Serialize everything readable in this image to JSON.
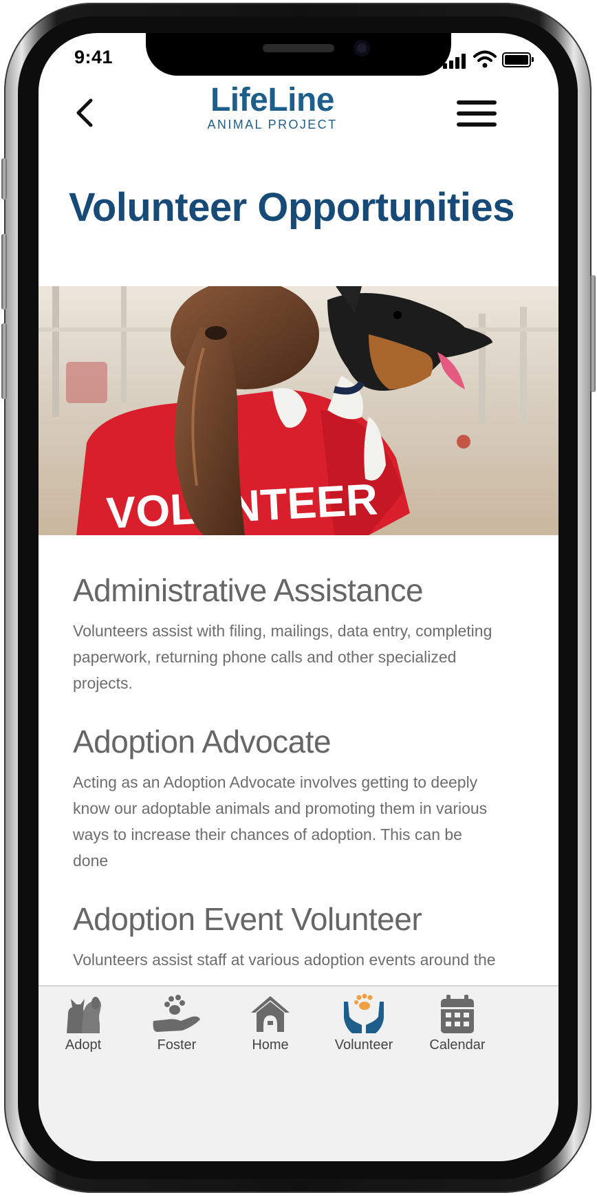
{
  "status_bar": {
    "time": "9:41"
  },
  "header": {
    "logo_name": "LifeLine",
    "logo_subtitle": "ANIMAL PROJECT",
    "back_icon": "chevron-left-icon",
    "menu_icon": "hamburger-menu-icon"
  },
  "page": {
    "title": "Volunteer Opportunities"
  },
  "hero": {
    "shirt_text": "VOLUNTEER"
  },
  "sections": [
    {
      "title": "Administrative Assistance",
      "body": "Volunteers assist with filing, mailings, data entry, completing paperwork, returning phone calls and other specialized projects."
    },
    {
      "title": "Adoption Advocate",
      "body": "Acting as an Adoption Advocate involves getting to deeply know our adoptable animals and promoting them in various ways to increase their chances of adoption. This can be done"
    },
    {
      "title": "Adoption Event Volunteer",
      "body": "Volunteers assist staff at various adoption events around the Atlanta area.  Duties include assisting in set up, maintaining the safety and well-being of the dogs, answering questions"
    }
  ],
  "tabbar": {
    "active": "Volunteer",
    "colors": {
      "inactive": "#6a6a6a",
      "active": "#1d5e8a",
      "paw_accent": "#f0a040"
    },
    "tabs": [
      {
        "label": "Adopt",
        "icon": "cat-dog-icon"
      },
      {
        "label": "Foster",
        "icon": "paw-hand-icon"
      },
      {
        "label": "Home",
        "icon": "house-icon"
      },
      {
        "label": "Volunteer",
        "icon": "hands-paw-icon"
      },
      {
        "label": "Calendar",
        "icon": "calendar-icon"
      }
    ]
  }
}
